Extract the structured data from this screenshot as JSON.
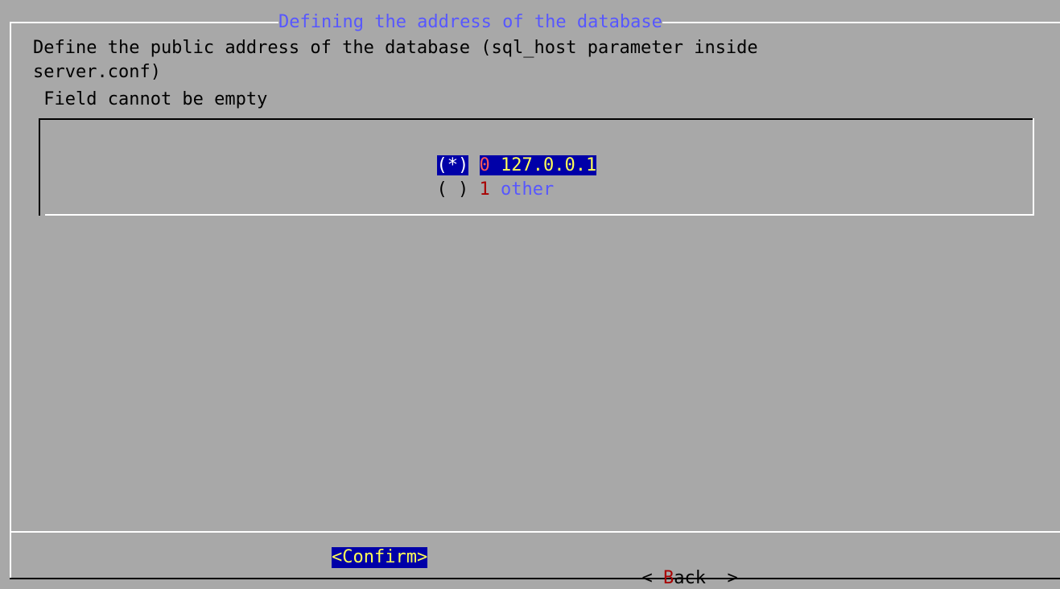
{
  "dialog": {
    "title": "Defining the address of the database",
    "message_line1": "Define the public address of the database (sql_host parameter inside",
    "message_line2": "server.conf)",
    "error_message": " Field cannot be empty"
  },
  "options": [
    {
      "marker": "(*)",
      "tag": "0",
      "label": "127.0.0.1",
      "selected": true
    },
    {
      "marker": "( )",
      "tag": "1",
      "label": "other",
      "selected": false
    }
  ],
  "buttons": {
    "confirm": "<Confirm>",
    "back_left": "< ",
    "back_hotkey": "B",
    "back_rest": "ack",
    "back_right": "  >"
  },
  "colors": {
    "background": "#a8a8a8",
    "title": "#5757ff",
    "selection_bg": "#0000a8",
    "selected_item": "#ffff57",
    "tag_red": "#a80000"
  }
}
